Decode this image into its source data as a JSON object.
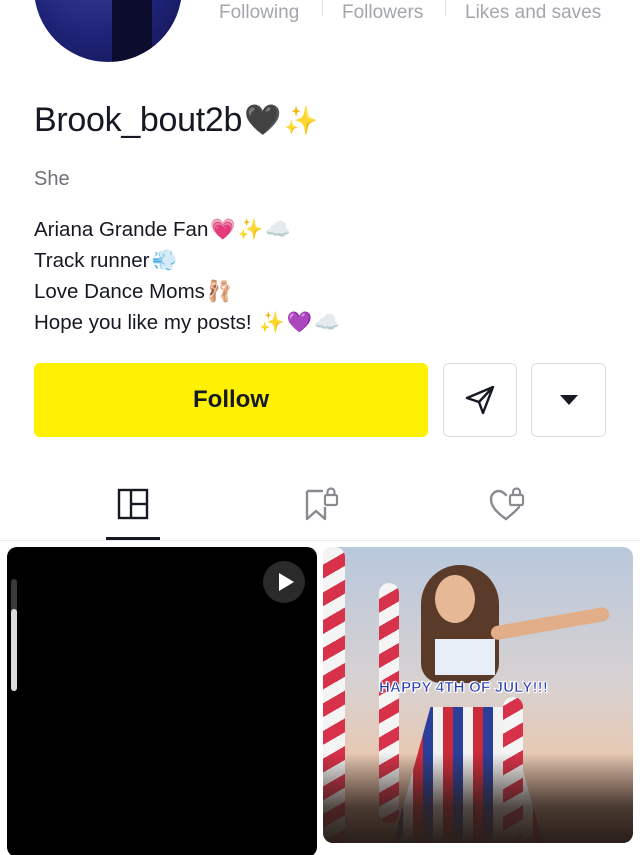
{
  "profile": {
    "username": "Brook_bout2b",
    "username_emojis": [
      "🖤",
      "✨"
    ],
    "pronoun": "She",
    "bio_lines": [
      {
        "text": "Ariana Grande Fan",
        "emojis": [
          "💗",
          "✨",
          "☁️"
        ]
      },
      {
        "text": "Track runner",
        "emojis": [
          "💨"
        ]
      },
      {
        "text": "Love Dance Moms",
        "emojis": [
          "🩰"
        ]
      },
      {
        "text": "Hope you like my posts! ",
        "emojis": [
          "✨",
          "💜",
          "☁️"
        ]
      }
    ]
  },
  "stats": {
    "following_label": "Following",
    "followers_label": "Followers",
    "likes_label": "Likes and saves"
  },
  "actions": {
    "follow_label": "Follow",
    "share_icon": "paper-plane-icon",
    "more_icon": "caret-down-icon"
  },
  "tabs": [
    {
      "name": "posts",
      "icon": "grid-icon",
      "active": true
    },
    {
      "name": "saved",
      "icon": "bookmark-lock-icon",
      "active": false
    },
    {
      "name": "liked",
      "icon": "heart-lock-icon",
      "active": false
    }
  ],
  "posts": [
    {
      "type": "video",
      "icon": "play-icon"
    },
    {
      "type": "image",
      "caption": "HAPPY 4TH OF JULY!!!"
    }
  ],
  "colors": {
    "follow_button": "#fff101",
    "primary_text": "#161823",
    "muted_text": "#a4a6ad"
  }
}
